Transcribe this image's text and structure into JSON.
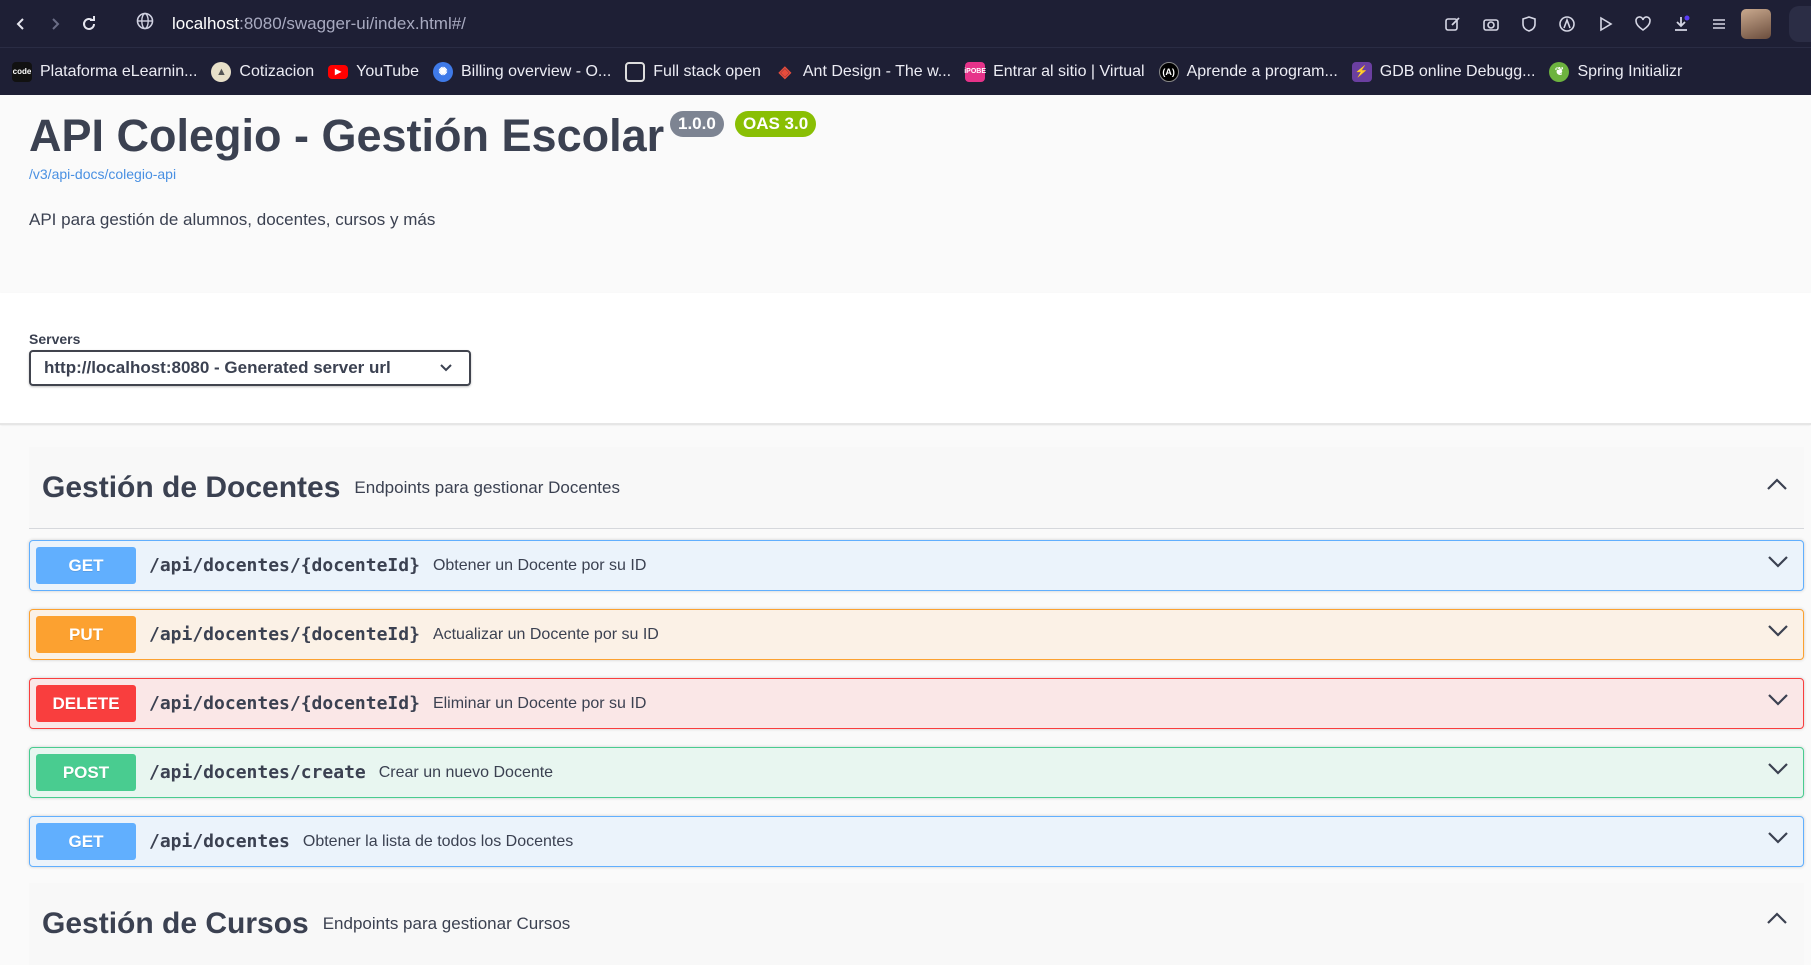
{
  "browser": {
    "url_host": "localhost",
    "url_rest": ":8080/swagger-ui/index.html#/",
    "bookmarks": [
      {
        "label": "Plataforma eLearnin...",
        "icon": "codigo-icon",
        "color": "#111111"
      },
      {
        "label": "Cotizacion",
        "icon": "mountain-icon",
        "color": "#e8e0c9"
      },
      {
        "label": "YouTube",
        "icon": "youtube-icon",
        "color": "#ff0000"
      },
      {
        "label": "Billing overview - O...",
        "icon": "openai-icon",
        "color": "#3f7ae8"
      },
      {
        "label": "Full stack open",
        "icon": "square-icon",
        "color": "#1e1f35"
      },
      {
        "label": "Ant Design - The w...",
        "icon": "antdesign-icon",
        "color": "#1e1f35"
      },
      {
        "label": "Entrar al sitio | Virtual",
        "icon": "virtual-icon",
        "color": "#e6338a"
      },
      {
        "label": "Aprende a program...",
        "icon": "platzi-icon",
        "color": "#000000"
      },
      {
        "label": "GDB online Debugg...",
        "icon": "gdb-icon",
        "color": "#6b3fa0"
      },
      {
        "label": "Spring Initializr",
        "icon": "spring-icon",
        "color": "#6db33f"
      }
    ]
  },
  "info": {
    "title": "API Colegio - Gestión Escolar",
    "version": "1.0.0",
    "oas": "OAS 3.0",
    "doc_link": "/v3/api-docs/colegio-api",
    "description": "API para gestión de alumnos, docentes, cursos y más"
  },
  "servers": {
    "label": "Servers",
    "selected": "http://localhost:8080 - Generated server url"
  },
  "tags": [
    {
      "name": "Gestión de Docentes",
      "description": "Endpoints para gestionar Docentes",
      "operations": [
        {
          "method": "GET",
          "path": "/api/docentes/{docenteId}",
          "summary": "Obtener un Docente por su ID"
        },
        {
          "method": "PUT",
          "path": "/api/docentes/{docenteId}",
          "summary": "Actualizar un Docente por su ID"
        },
        {
          "method": "DELETE",
          "path": "/api/docentes/{docenteId}",
          "summary": "Eliminar un Docente por su ID"
        },
        {
          "method": "POST",
          "path": "/api/docentes/create",
          "summary": "Crear un nuevo Docente"
        },
        {
          "method": "GET",
          "path": "/api/docentes",
          "summary": "Obtener la lista de todos los Docentes"
        }
      ]
    },
    {
      "name": "Gestión de Cursos",
      "description": "Endpoints para gestionar Cursos",
      "operations": []
    }
  ],
  "colors": {
    "get": "#61affe",
    "put": "#fca130",
    "delete": "#f93e3e",
    "post": "#49cc90"
  }
}
